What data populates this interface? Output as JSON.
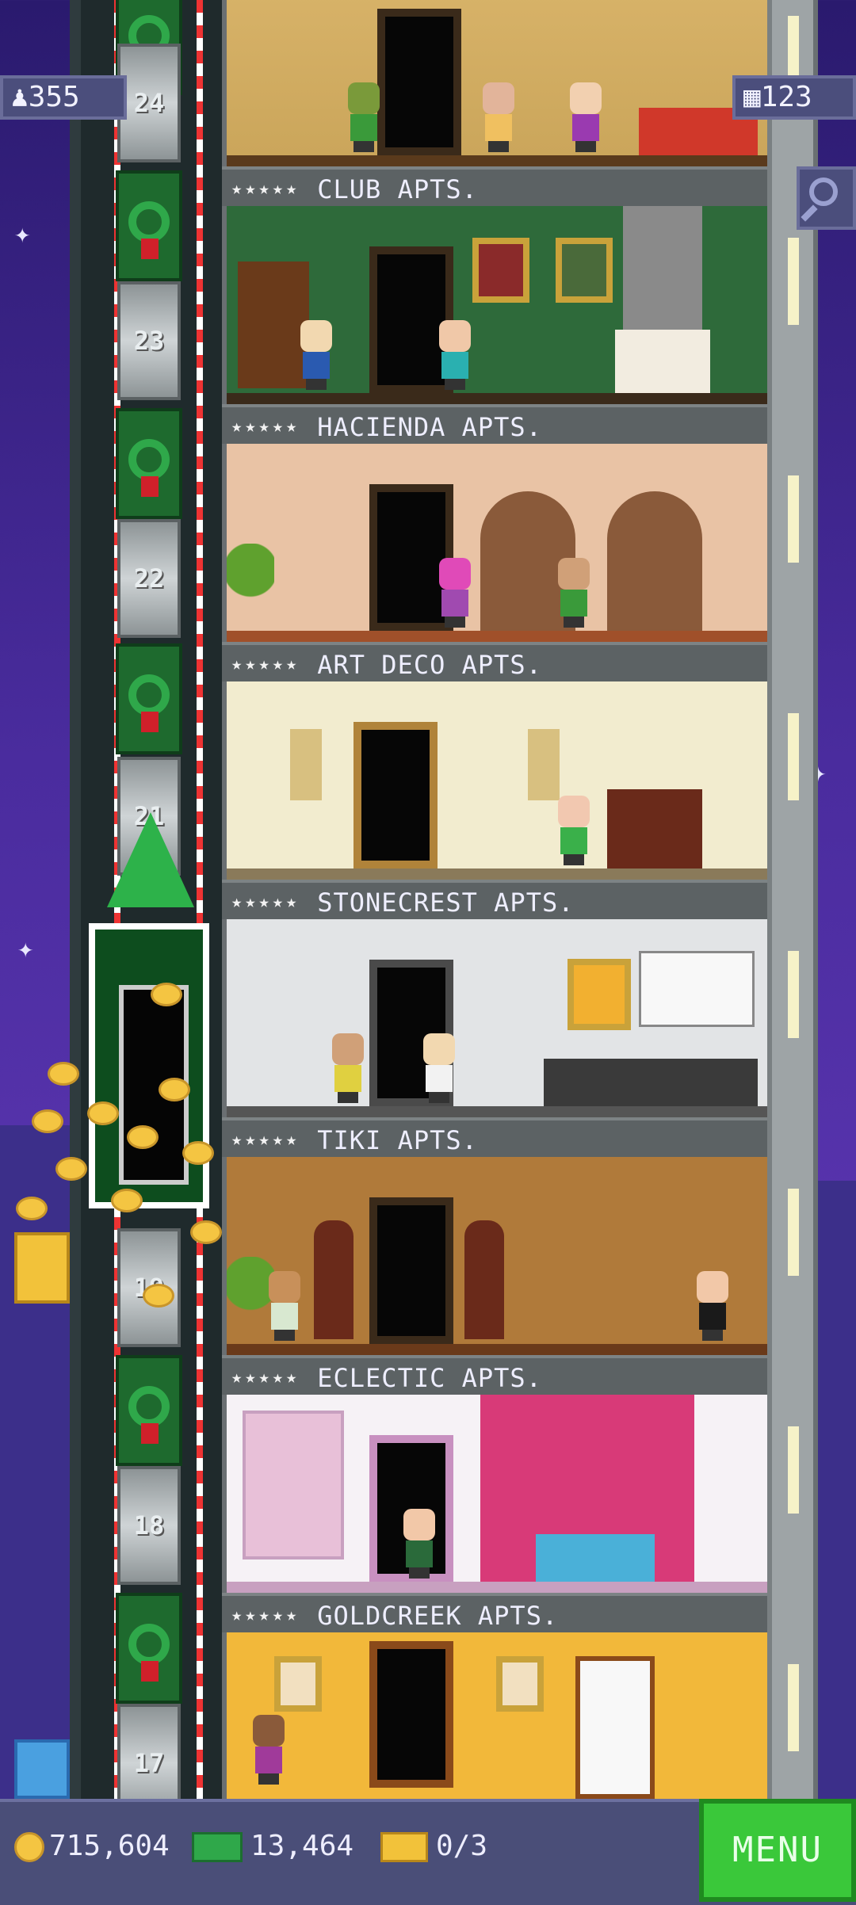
{
  "hud": {
    "population": "355",
    "floor_count": "123",
    "search_icon": "magnifier-icon"
  },
  "floors": [
    {
      "name": "CLUB APTS.",
      "shaft_number": "24"
    },
    {
      "name": "HACIENDA APTS.",
      "shaft_number": "23"
    },
    {
      "name": "ART DECO APTS.",
      "shaft_number": "22"
    },
    {
      "name": "STONECREST APTS.",
      "shaft_number": "21"
    },
    {
      "name": "TIKI APTS.",
      "shaft_number": ""
    },
    {
      "name": "ECLECTIC APTS.",
      "shaft_number": "19"
    },
    {
      "name": "GOLDCREEK APTS.",
      "shaft_number": "18"
    },
    {
      "name": "",
      "shaft_number": "17"
    }
  ],
  "floor_stars": "★★★★★",
  "bottom_bar": {
    "coins": "715,604",
    "bux": "13,464",
    "tickets": "0/3",
    "menu_label": "MENU"
  },
  "colors": {
    "sky": "#4a2c9e",
    "menu_button": "#3ac83a",
    "hud_panel": "#4b4e7c"
  }
}
